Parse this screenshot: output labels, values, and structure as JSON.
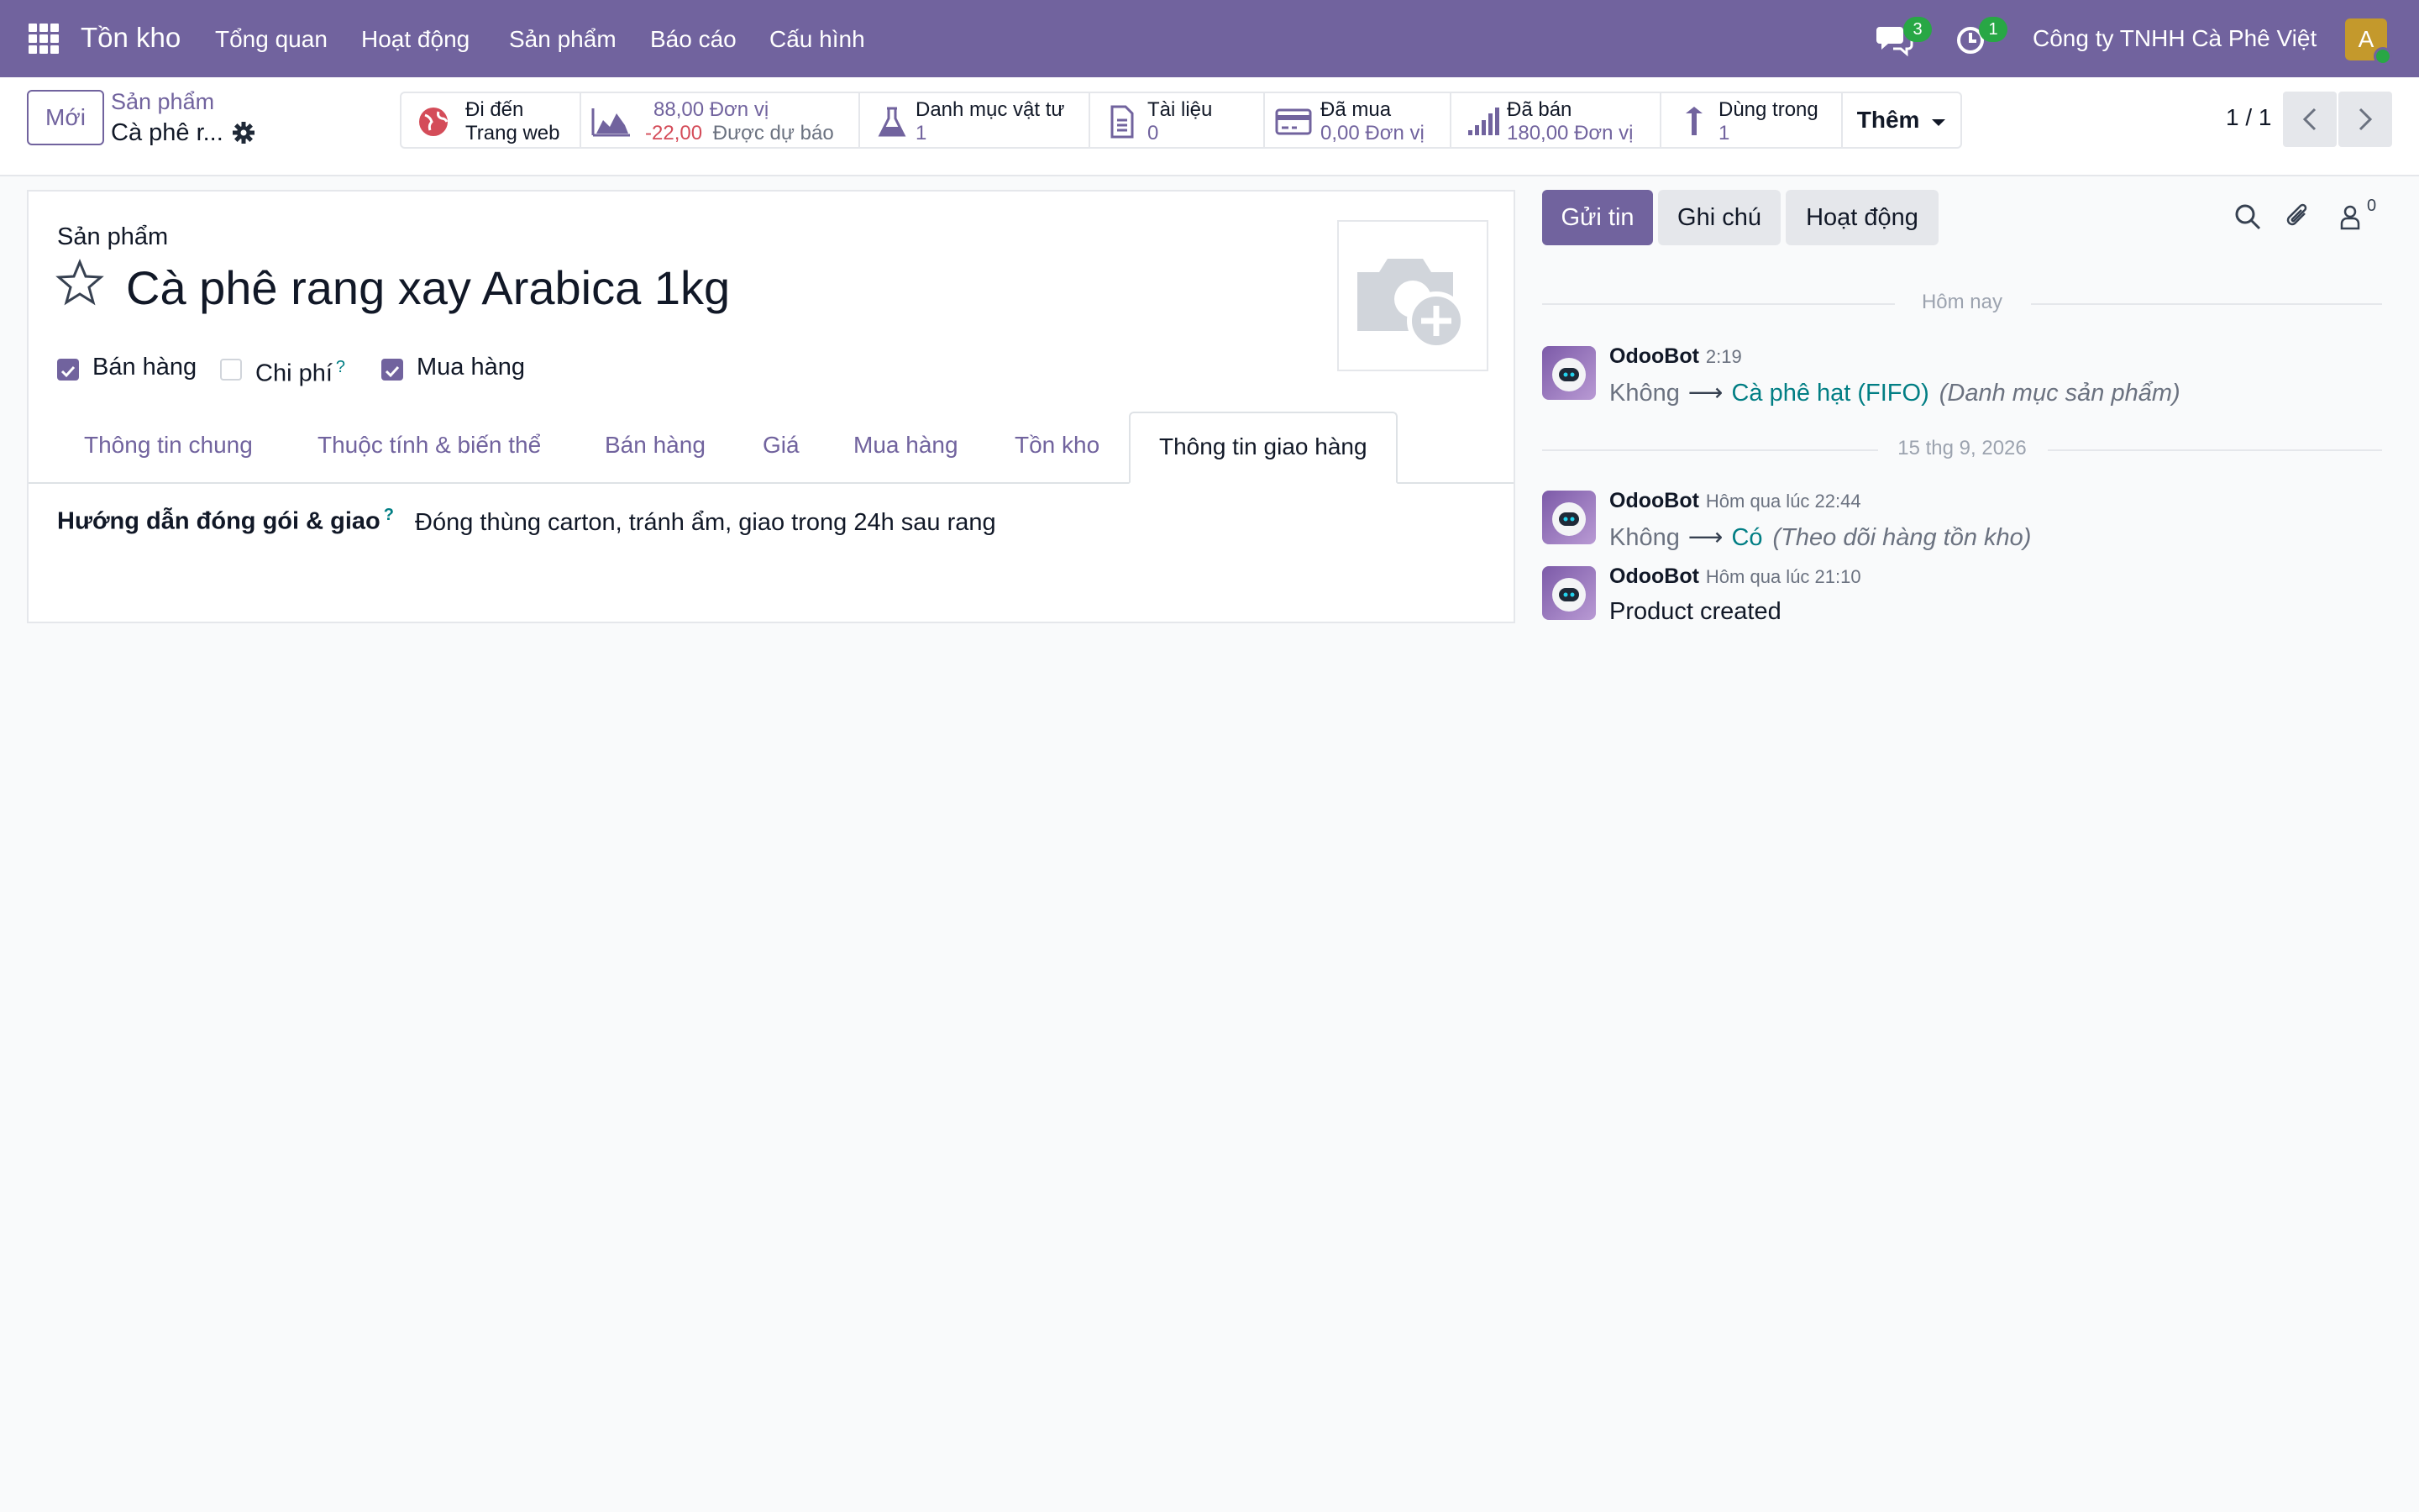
{
  "topbar": {
    "app_name": "Tồn kho",
    "menu": [
      "Tổng quan",
      "Hoạt động",
      "Sản phẩm",
      "Báo cáo",
      "Cấu hình"
    ],
    "messages_count": "3",
    "activities_count": "1",
    "company": "Công ty TNHH Cà Phê Việt",
    "avatar_letter": "A"
  },
  "control": {
    "new_label": "Mới",
    "breadcrumb_parent": "Sản phẩm",
    "breadcrumb_current": "Cà phê r...",
    "pager": "1 / 1",
    "more_label": "Thêm"
  },
  "smart_buttons": {
    "website": {
      "line1": "Đi đến",
      "line2": "Trang web"
    },
    "forecast": {
      "on_hand": "88,00 Đơn vị",
      "forecast_value": "-22,00",
      "forecast_label": "Được dự báo"
    },
    "bom": {
      "label": "Danh mục vật tư",
      "value": "1"
    },
    "documents": {
      "label": "Tài liệu",
      "value": "0"
    },
    "purchased": {
      "label": "Đã mua",
      "value": "0,00 Đơn vị"
    },
    "sold": {
      "label": "Đã bán",
      "value": "180,00 Đơn vị"
    },
    "used_in": {
      "label": "Dùng trong",
      "value": "1"
    }
  },
  "form": {
    "kind_label": "Sản phẩm",
    "product_name": "Cà phê rang xay Arabica 1kg",
    "checkboxes": [
      {
        "label": "Bán hàng",
        "checked": true
      },
      {
        "label": "Chi phí",
        "checked": false,
        "help": "?"
      },
      {
        "label": "Mua hàng",
        "checked": true
      }
    ],
    "tabs": [
      "Thông tin chung",
      "Thuộc tính & biến thể",
      "Bán hàng",
      "Giá",
      "Mua hàng",
      "Tồn kho",
      "Thông tin giao hàng"
    ],
    "active_tab": "Thông tin giao hàng",
    "field_label": "Hướng dẫn đóng gói & giao",
    "field_help": "?",
    "field_value": "Đóng thùng carton, tránh ẩm, giao trong 24h sau rang"
  },
  "chatter": {
    "send_message": "Gửi tin",
    "log_note": "Ghi chú",
    "activities": "Hoạt động",
    "followers_count": "0",
    "separator_today": "Hôm nay",
    "separator_date": "15 thg 9, 2026",
    "messages": [
      {
        "author": "OdooBot",
        "date": "2:19",
        "old": "Không",
        "new": "Cà phê hạt (FIFO)",
        "field": "(Danh mục sản phẩm)"
      },
      {
        "author": "OdooBot",
        "date": "Hôm qua lúc 22:44",
        "old": "Không",
        "new": "Có",
        "field": "(Theo dõi hàng tồn kho)"
      },
      {
        "author": "OdooBot",
        "date": "Hôm qua lúc 21:10",
        "text": "Product created"
      }
    ]
  },
  "colors": {
    "brand": "#71639e",
    "teal": "#017e84",
    "danger": "#d44c59",
    "success": "#28a745"
  }
}
